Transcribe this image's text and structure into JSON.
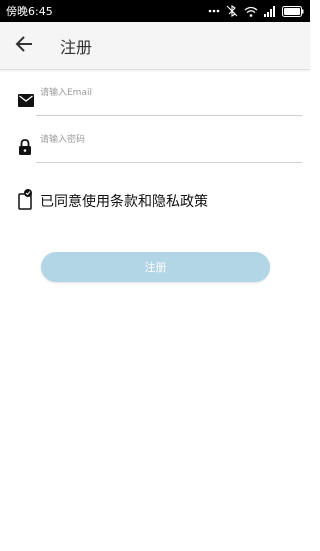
{
  "status_bar": {
    "time": "傍晚6:45"
  },
  "app_bar": {
    "title": "注册"
  },
  "form": {
    "email_placeholder": "请输入Email",
    "password_placeholder": "请输入密码",
    "agree_label": "已同意使用条款和隐私政策",
    "submit_label": "注册"
  },
  "colors": {
    "button": "#b3d6e6",
    "status_bar": "#000000",
    "app_bar": "#f5f5f5"
  },
  "icons": [
    "back-arrow-icon",
    "mail-icon",
    "lock-icon",
    "checkbox-icon"
  ]
}
